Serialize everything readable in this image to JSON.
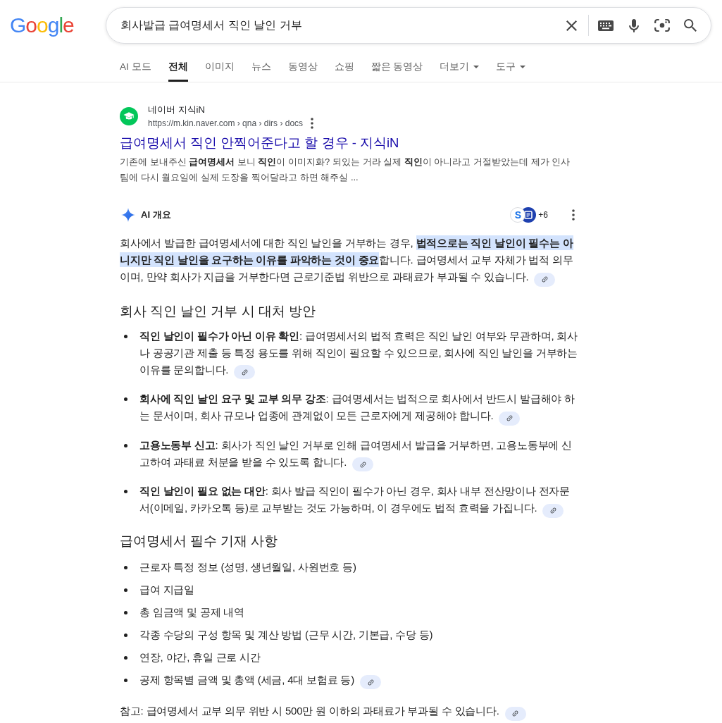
{
  "header": {
    "logo": "Google",
    "search": {
      "value": "회사발급 급여명세서 직인 날인 거부"
    }
  },
  "tabs": [
    {
      "label": "AI 모드",
      "selected": false,
      "kind": "link"
    },
    {
      "label": "전체",
      "selected": true,
      "kind": "link"
    },
    {
      "label": "이미지",
      "selected": false,
      "kind": "link"
    },
    {
      "label": "뉴스",
      "selected": false,
      "kind": "link"
    },
    {
      "label": "동영상",
      "selected": false,
      "kind": "link"
    },
    {
      "label": "쇼핑",
      "selected": false,
      "kind": "link"
    },
    {
      "label": "짧은 동영상",
      "selected": false,
      "kind": "link"
    },
    {
      "label": "더보기",
      "selected": false,
      "kind": "menu"
    },
    {
      "label": "도구",
      "selected": false,
      "kind": "menu"
    }
  ],
  "result": {
    "site_name": "네이버 지식iN",
    "url": "https://m.kin.naver.com › qna › dirs › docs",
    "title": "급여명세서 직인 안찍어준다고 할 경우 - 지식iN",
    "snippet": "기존에 보내주신 **급여명세서** 보니 **직인**이 이미지화? 되있는 거라 실제 **직인**이 아니라고 거절받았는데 제가 인사팀에 다시 월요일에 실제 도장을 찍어달라고 하면 해주실 ..."
  },
  "ai_overview": {
    "title": "AI 개요",
    "sources": [
      {
        "kind": "letter",
        "text": "S"
      },
      {
        "kind": "logo"
      }
    ],
    "more_sources": "+6",
    "intro": {
      "segments": [
        {
          "text": "회사에서 발급한 급여명세서에 대한 직인 날인을 거부하는 경우, ",
          "highlighted": false
        },
        {
          "text": "법적으로는 직인 날인이 필수는 아니지만 직인 날인을 요구하는 이유를 파악하는 것이 중요",
          "highlighted": true
        },
        {
          "text": "합니다. 급여명세서 교부 자체가 법적 의무이며, 만약 회사가 지급을 거부한다면 근로기준법 위반으로 과태료가 부과될 수 있습니다.",
          "highlighted": false
        }
      ],
      "citation": true
    },
    "sections": [
      {
        "heading": "회사 직인 날인 거부 시 대처 방안",
        "kind": "terms",
        "items": [
          {
            "text": "**직인 날인이 필수가 아닌 이유 확인**: 급여명세서의 법적 효력은 직인 날인 여부와 무관하며, 회사나 공공기관 제출 등 특정 용도를 위해 직인이 필요할 수 있으므로, 회사에 직인 날인을 거부하는 이유를 문의합니다.",
            "citation": true
          },
          {
            "text": "**회사에 직인 날인 요구 및 교부 의무 강조**: 급여명세서는 법적으로 회사에서 반드시 발급해야 하는 문서이며, 회사 규모나 업종에 관계없이 모든 근로자에게 제공해야 합니다.",
            "citation": true
          },
          {
            "text": "**고용노동부 신고**: 회사가 직인 날인 거부로 인해 급여명세서 발급을 거부하면, 고용노동부에 신고하여 과태료 처분을 받을 수 있도록 합니다.",
            "citation": true
          },
          {
            "text": "**직인 날인이 필요 없는 대안**: 회사 발급 직인이 필수가 아닌 경우, 회사 내부 전산망이나 전자문서(이메일, 카카오톡 등)로 교부받는 것도 가능하며, 이 경우에도 법적 효력을 가집니다.",
            "citation": true
          }
        ]
      },
      {
        "heading": "급여명세서 필수 기재 사항",
        "kind": "plain",
        "items": [
          {
            "text": "근로자 특정 정보 (성명, 생년월일, 사원번호 등)",
            "citation": false
          },
          {
            "text": "급여 지급일",
            "citation": false
          },
          {
            "text": "총 임금액 및 공제 내역",
            "citation": false
          },
          {
            "text": "각종 수당의 구성 항목 및 계산 방법 (근무 시간, 기본급, 수당 등)",
            "citation": false
          },
          {
            "text": "연장, 야간, 휴일 근로 시간",
            "citation": false
          },
          {
            "text": "공제 항목별 금액 및 총액 (세금, 4대 보험료 등)",
            "citation": true
          }
        ]
      }
    ],
    "note": {
      "text": "참고: 급여명세서 교부 의무 위반 시 500만 원 이하의 과태료가 부과될 수 있습니다.",
      "citation": true
    }
  }
}
